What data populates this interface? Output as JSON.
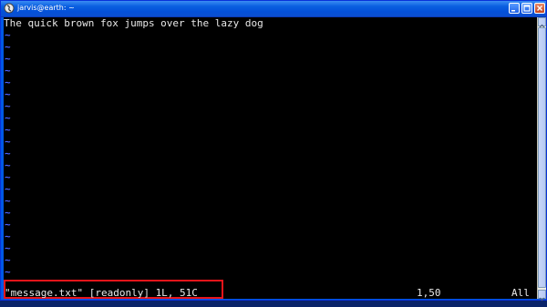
{
  "window": {
    "title": "jarvis@earth: ~",
    "icons": {
      "app": "terminal-app-icon",
      "minimize": "minimize-icon",
      "maximize": "maximize-icon",
      "close": "close-icon"
    }
  },
  "editor": {
    "content_lines": [
      "The quick brown fox jumps over the lazy dog"
    ],
    "empty_line_marker": "~",
    "empty_line_count": 21
  },
  "status_bar": {
    "message": "\"message.txt\" [readonly] 1L, 51C",
    "cursor_position": "1,50",
    "scroll_position": "All"
  },
  "colors": {
    "background": "#000000",
    "text": "#e8e8e8",
    "tilde": "#4a63ff",
    "highlight_border": "#e8141a",
    "titlebar": "#0450d9"
  }
}
